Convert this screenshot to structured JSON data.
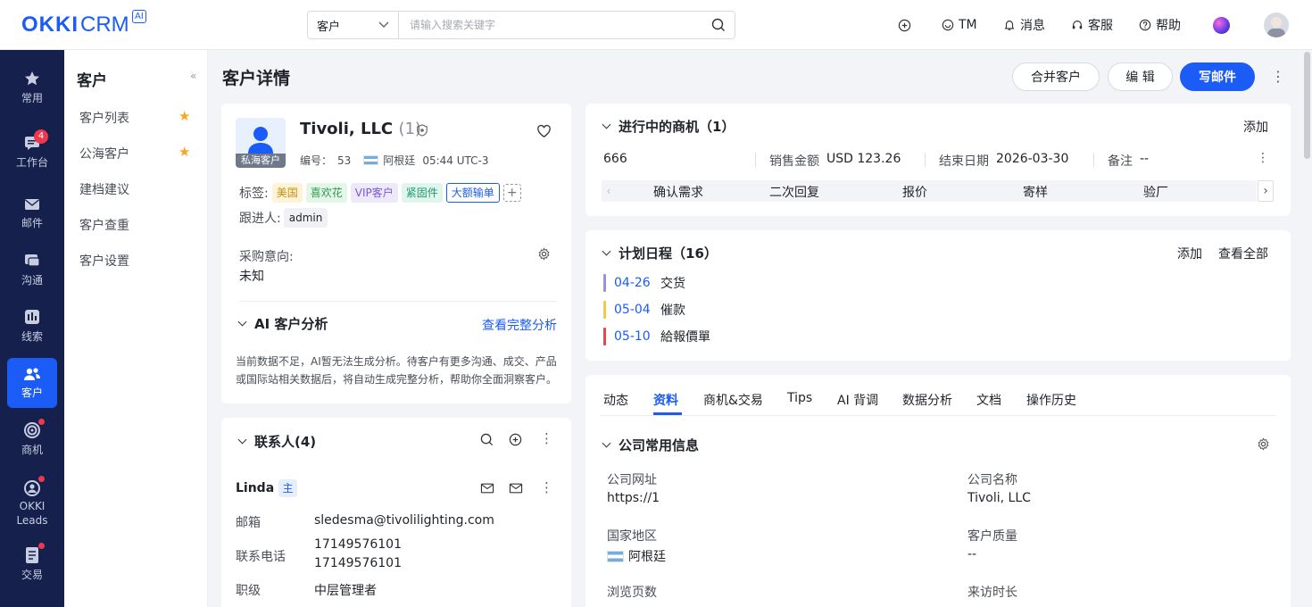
{
  "brand": {
    "name_bold": "OKKI",
    "name_light": "CRM",
    "ai_badge": "AI"
  },
  "search": {
    "scope": "客户",
    "placeholder": "请输入搜索关键字"
  },
  "top_actions": {
    "tm": "TM",
    "messages": "消息",
    "service": "客服",
    "help": "帮助"
  },
  "sidebar": {
    "items": [
      {
        "label": "常用"
      },
      {
        "label": "工作台",
        "badge": "4"
      },
      {
        "label": "邮件"
      },
      {
        "label": "沟通"
      },
      {
        "label": "线索"
      },
      {
        "label": "客户"
      },
      {
        "label": "商机"
      },
      {
        "label": "OKKI Leads"
      },
      {
        "label": "交易"
      }
    ]
  },
  "subnav": {
    "title": "客户",
    "collapse": "«",
    "items": [
      "客户列表",
      "公海客户",
      "建档建议",
      "客户查重",
      "客户设置"
    ]
  },
  "page": {
    "title": "客户详情"
  },
  "header_buttons": {
    "merge": "合并客户",
    "edit": "编 辑",
    "write_mail": "写邮件"
  },
  "customer": {
    "name": "Tivoli, LLC",
    "count": "(1)",
    "avatar_tag": "私海客户",
    "id_label": "编号：",
    "id_value": "53",
    "country": "阿根廷",
    "time": "05:44 UTC-3",
    "tags_label": "标签:",
    "tags": [
      "美国",
      "喜欢花",
      "VIP客户",
      "紧固件",
      "大额输单"
    ],
    "tag_add": "+",
    "follower_label": "跟进人:",
    "follower": "admin",
    "intent_label": "采购意向:",
    "intent_value": "未知"
  },
  "ai_analysis": {
    "title": "AI 客户分析",
    "link": "查看完整分析",
    "text_line1": "当前数据不足，AI暂无法生成分析。待客户有更多沟通、成交、产品",
    "text_line2": "或国际站相关数据后，将自动生成完整分析，帮助你全面洞察客户。"
  },
  "contacts": {
    "title": "联系人(4)",
    "name": "Linda",
    "primary_badge": "主",
    "email_label": "邮箱",
    "email": "sledesma@tivolilighting.com",
    "phone_label": "联系电话",
    "phone1": "17149576101",
    "phone2": "17149576101",
    "level_label": "职级",
    "level": "中层管理者"
  },
  "opportunities": {
    "title": "进行中的商机（1）",
    "add": "添加",
    "name": "666",
    "amount_label": "销售金额",
    "amount": "USD 123.26",
    "end_label": "结束日期",
    "end_date": "2026-03-30",
    "note_label": "备注",
    "note": "--",
    "stages": [
      "确认需求",
      "二次回复",
      "报价",
      "寄样",
      "验厂"
    ]
  },
  "schedule": {
    "title": "计划日程（16）",
    "add": "添加",
    "view_all": "查看全部",
    "items": [
      {
        "date": "04-26",
        "text": "交货",
        "color": "#9b8fe0"
      },
      {
        "date": "05-04",
        "text": "催款",
        "color": "#f2c94c"
      },
      {
        "date": "05-10",
        "text": "給報價單",
        "color": "#e5484d"
      }
    ]
  },
  "tabs": [
    "动态",
    "资料",
    "商机&交易",
    "Tips",
    "AI 背调",
    "数据分析",
    "文档",
    "操作历史"
  ],
  "company_info": {
    "title": "公司常用信息",
    "website_label": "公司网址",
    "website": "https://1",
    "name_label": "公司名称",
    "name": "Tivoli, LLC",
    "country_label": "国家地区",
    "country": "阿根廷",
    "quality_label": "客户质量",
    "quality": "--",
    "pageviews_label": "浏览页数",
    "visit_label": "来访时长"
  },
  "colors": {
    "accent": "#1a5cf5",
    "sidebar": "#15204d",
    "badge": "#f0384c",
    "star": "#f5a623"
  }
}
